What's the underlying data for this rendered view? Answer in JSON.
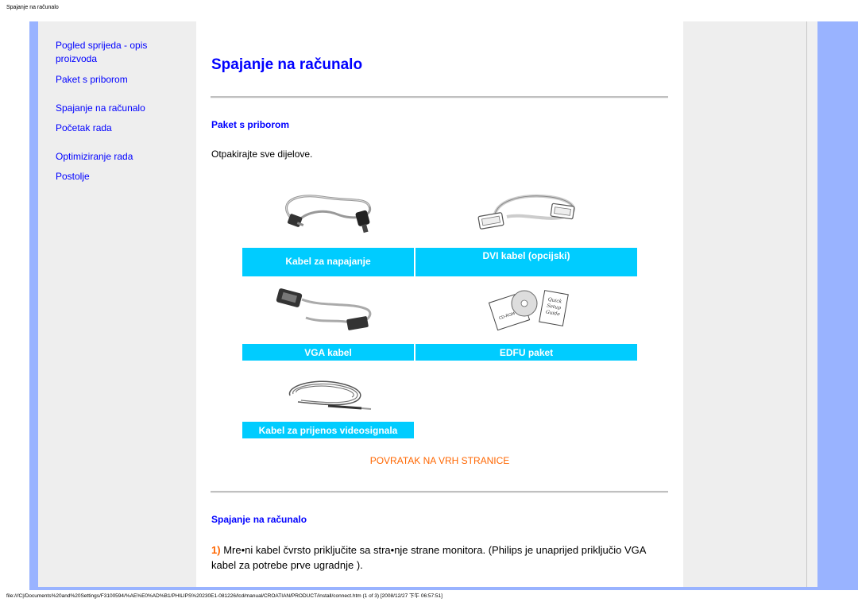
{
  "header": {
    "title": "Spajanje na računalo"
  },
  "nav": {
    "items": [
      "Pogled sprijeda - opis proizvoda",
      "Paket s priborom",
      "Spajanje na računalo",
      "Početak rada",
      "Optimiziranje rada",
      "Postolje"
    ]
  },
  "main": {
    "title": "Spajanje na računalo",
    "section1": {
      "heading": "Paket s priborom",
      "intro": "Otpakirajte sve dijelove.",
      "labels": {
        "power_cable": "Kabel za napajanje",
        "dvi_cable": "DVI kabel (opcijski)",
        "vga_cable": "VGA kabel",
        "edfu": "EDFU paket",
        "video_cable": "Kabel za prijenos videosignala"
      },
      "back_to_top": "POVRATAK NA VRH STRANICE"
    },
    "section2": {
      "heading": "Spajanje na računalo",
      "step_number": "1)",
      "step_text": "Mre•ni kabel čvrsto priključite sa stra•nje strane monitora. (Philips je unaprijed priključio VGA kabel za potrebe prve ugradnje )."
    }
  },
  "footer": {
    "path": "file:///C|/Documents%20and%20Settings/F3100594/%AE%E0%AD%B1/PHILIPS%20230E1-081226/lcd/manual/CROATIAN/PRODUCT/install/connect.htm (1 of 3) [2008/12/27 下午 06:57:51]"
  },
  "colors": {
    "accent_bar": "#99b3ff",
    "table_cell": "#00ccff",
    "link": "#0000ff",
    "highlight": "#ff6600"
  },
  "icons": [
    "power-cable-image",
    "dvi-cable-image",
    "vga-cable-image",
    "edfu-package-image",
    "video-cable-image"
  ]
}
